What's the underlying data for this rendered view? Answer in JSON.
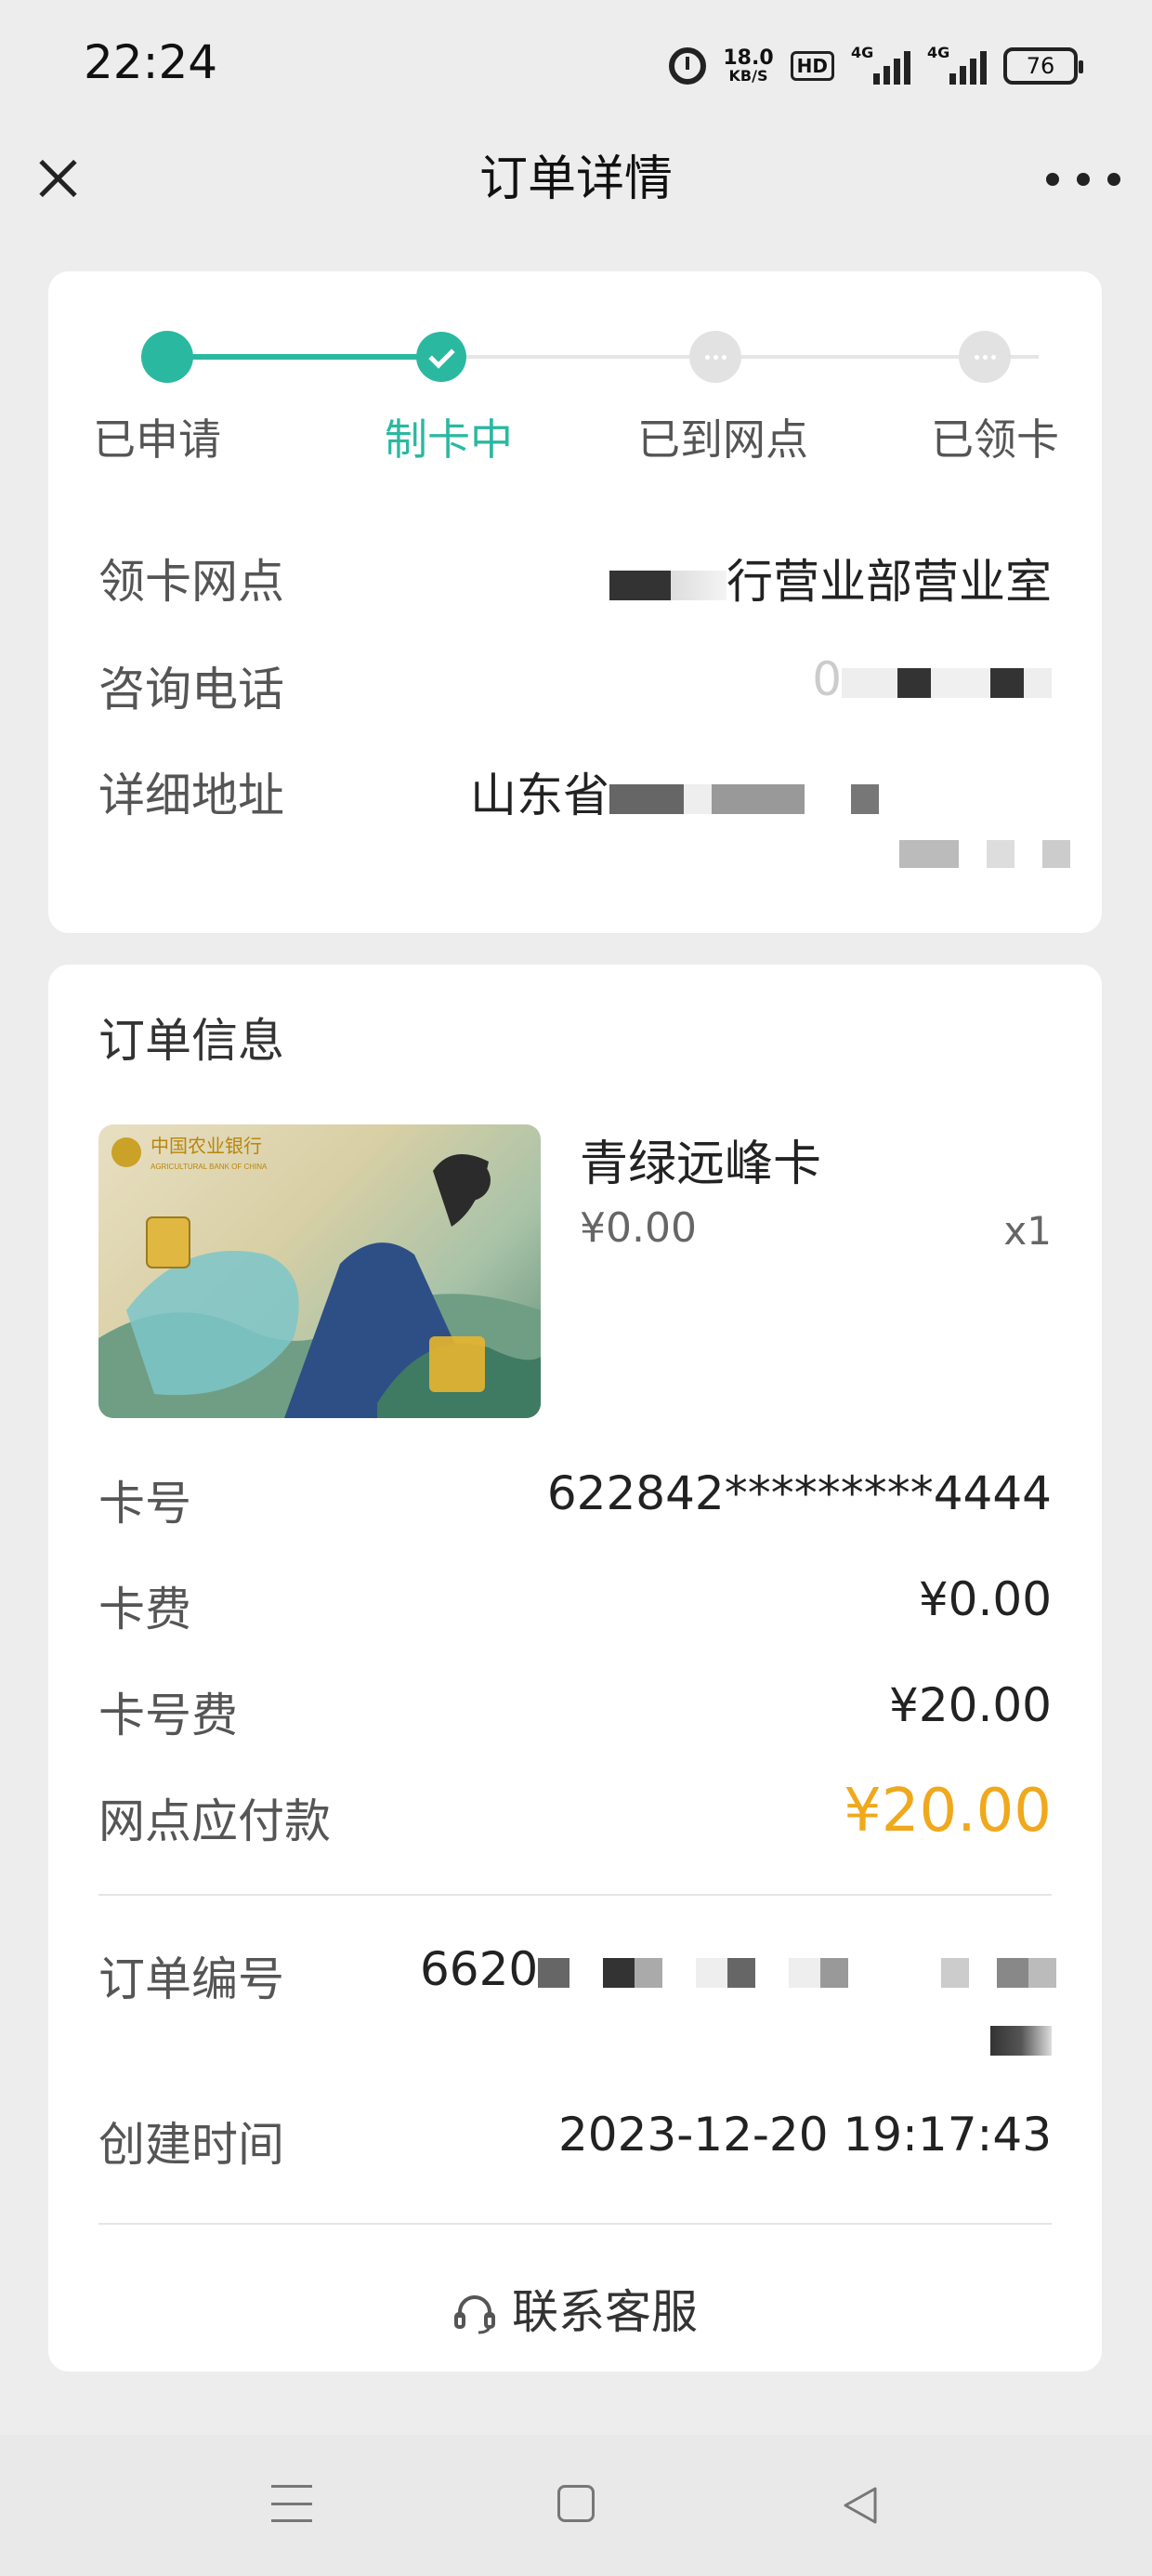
{
  "status_bar": {
    "time": "22:24",
    "net_speed": "18.0",
    "net_unit": "KB/S",
    "hd": "HD",
    "signal1": "4G",
    "signal2": "4G",
    "battery": "76"
  },
  "nav": {
    "title": "订单详情"
  },
  "progress": {
    "steps": [
      "已申请",
      "制卡中",
      "已到网点",
      "已领卡"
    ],
    "current_index": 1,
    "accent": "#2bb8a0"
  },
  "branch_info": {
    "branch_label": "领卡网点",
    "branch_value": "行营业部营业室",
    "phone_label": "咨询电话",
    "phone_value": "0",
    "address_label": "详细地址",
    "address_value": "山东省"
  },
  "order_info": {
    "section_title": "订单信息",
    "product_name": "青绿远峰卡",
    "product_price": "¥0.00",
    "product_qty": "x1",
    "card_no_label": "卡号",
    "card_no_value": "622842*********4444",
    "card_fee_label": "卡费",
    "card_fee_value": "¥0.00",
    "number_fee_label": "卡号费",
    "number_fee_value": "¥20.00",
    "payable_label": "网点应付款",
    "payable_value": "¥20.00",
    "payable_color": "#f0a81c",
    "order_no_label": "订单编号",
    "order_no_value": "6620",
    "created_label": "创建时间",
    "created_value": "2023-12-20 19:17:43",
    "service_label": "联系客服"
  },
  "card_art": {
    "bank_name": "中国农业银行",
    "bank_name_en": "AGRICULTURAL BANK OF CHINA"
  }
}
